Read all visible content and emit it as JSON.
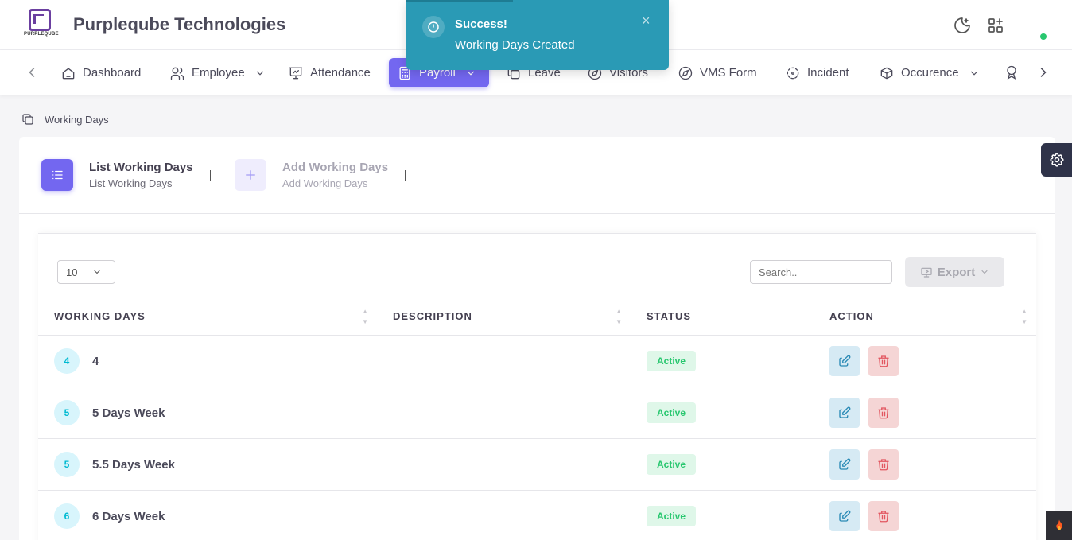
{
  "header": {
    "company": "Purpleqube Technologies",
    "logo_text": "PURPLEQUBE"
  },
  "nav": {
    "items": [
      {
        "label": "Dashboard",
        "icon": "home-icon"
      },
      {
        "label": "Employee",
        "icon": "users-icon"
      },
      {
        "label": "Attendance",
        "icon": "presentation-icon"
      },
      {
        "label": "Payroll",
        "icon": "calculator-icon"
      },
      {
        "label": "Leave",
        "icon": "copy-icon"
      },
      {
        "label": "Visitors",
        "icon": "compass-icon"
      },
      {
        "label": "VMS Form",
        "icon": "compass-icon"
      },
      {
        "label": "Incident",
        "icon": "focus-icon"
      },
      {
        "label": "Occurence",
        "icon": "packages-icon"
      }
    ]
  },
  "toast": {
    "title": "Success!",
    "message": "Working Days Created",
    "close": "×"
  },
  "breadcrumb": {
    "current": "Working Days"
  },
  "tabs": {
    "list": {
      "title": "List Working Days",
      "subtitle": "List Working Days"
    },
    "add": {
      "title": "Add Working Days",
      "subtitle": "Add Working Days"
    }
  },
  "table_controls": {
    "page_length": "10",
    "search_placeholder": "Search..",
    "export_label": "Export"
  },
  "table": {
    "columns": [
      "WORKING DAYS",
      "DESCRIPTION",
      "STATUS",
      "ACTION"
    ],
    "rows": [
      {
        "avatar": "4",
        "name": "4",
        "description": "",
        "status": "Active"
      },
      {
        "avatar": "5",
        "name": "5 Days Week",
        "description": "",
        "status": "Active"
      },
      {
        "avatar": "5",
        "name": "5.5 Days Week",
        "description": "",
        "status": "Active"
      },
      {
        "avatar": "6",
        "name": "6 Days Week",
        "description": "",
        "status": "Active"
      }
    ]
  },
  "colors": {
    "primary": "#7367f0",
    "toast": "#2a9ab5",
    "success": "#28c76f",
    "info": "#00bad1",
    "danger": "#e2555f"
  }
}
